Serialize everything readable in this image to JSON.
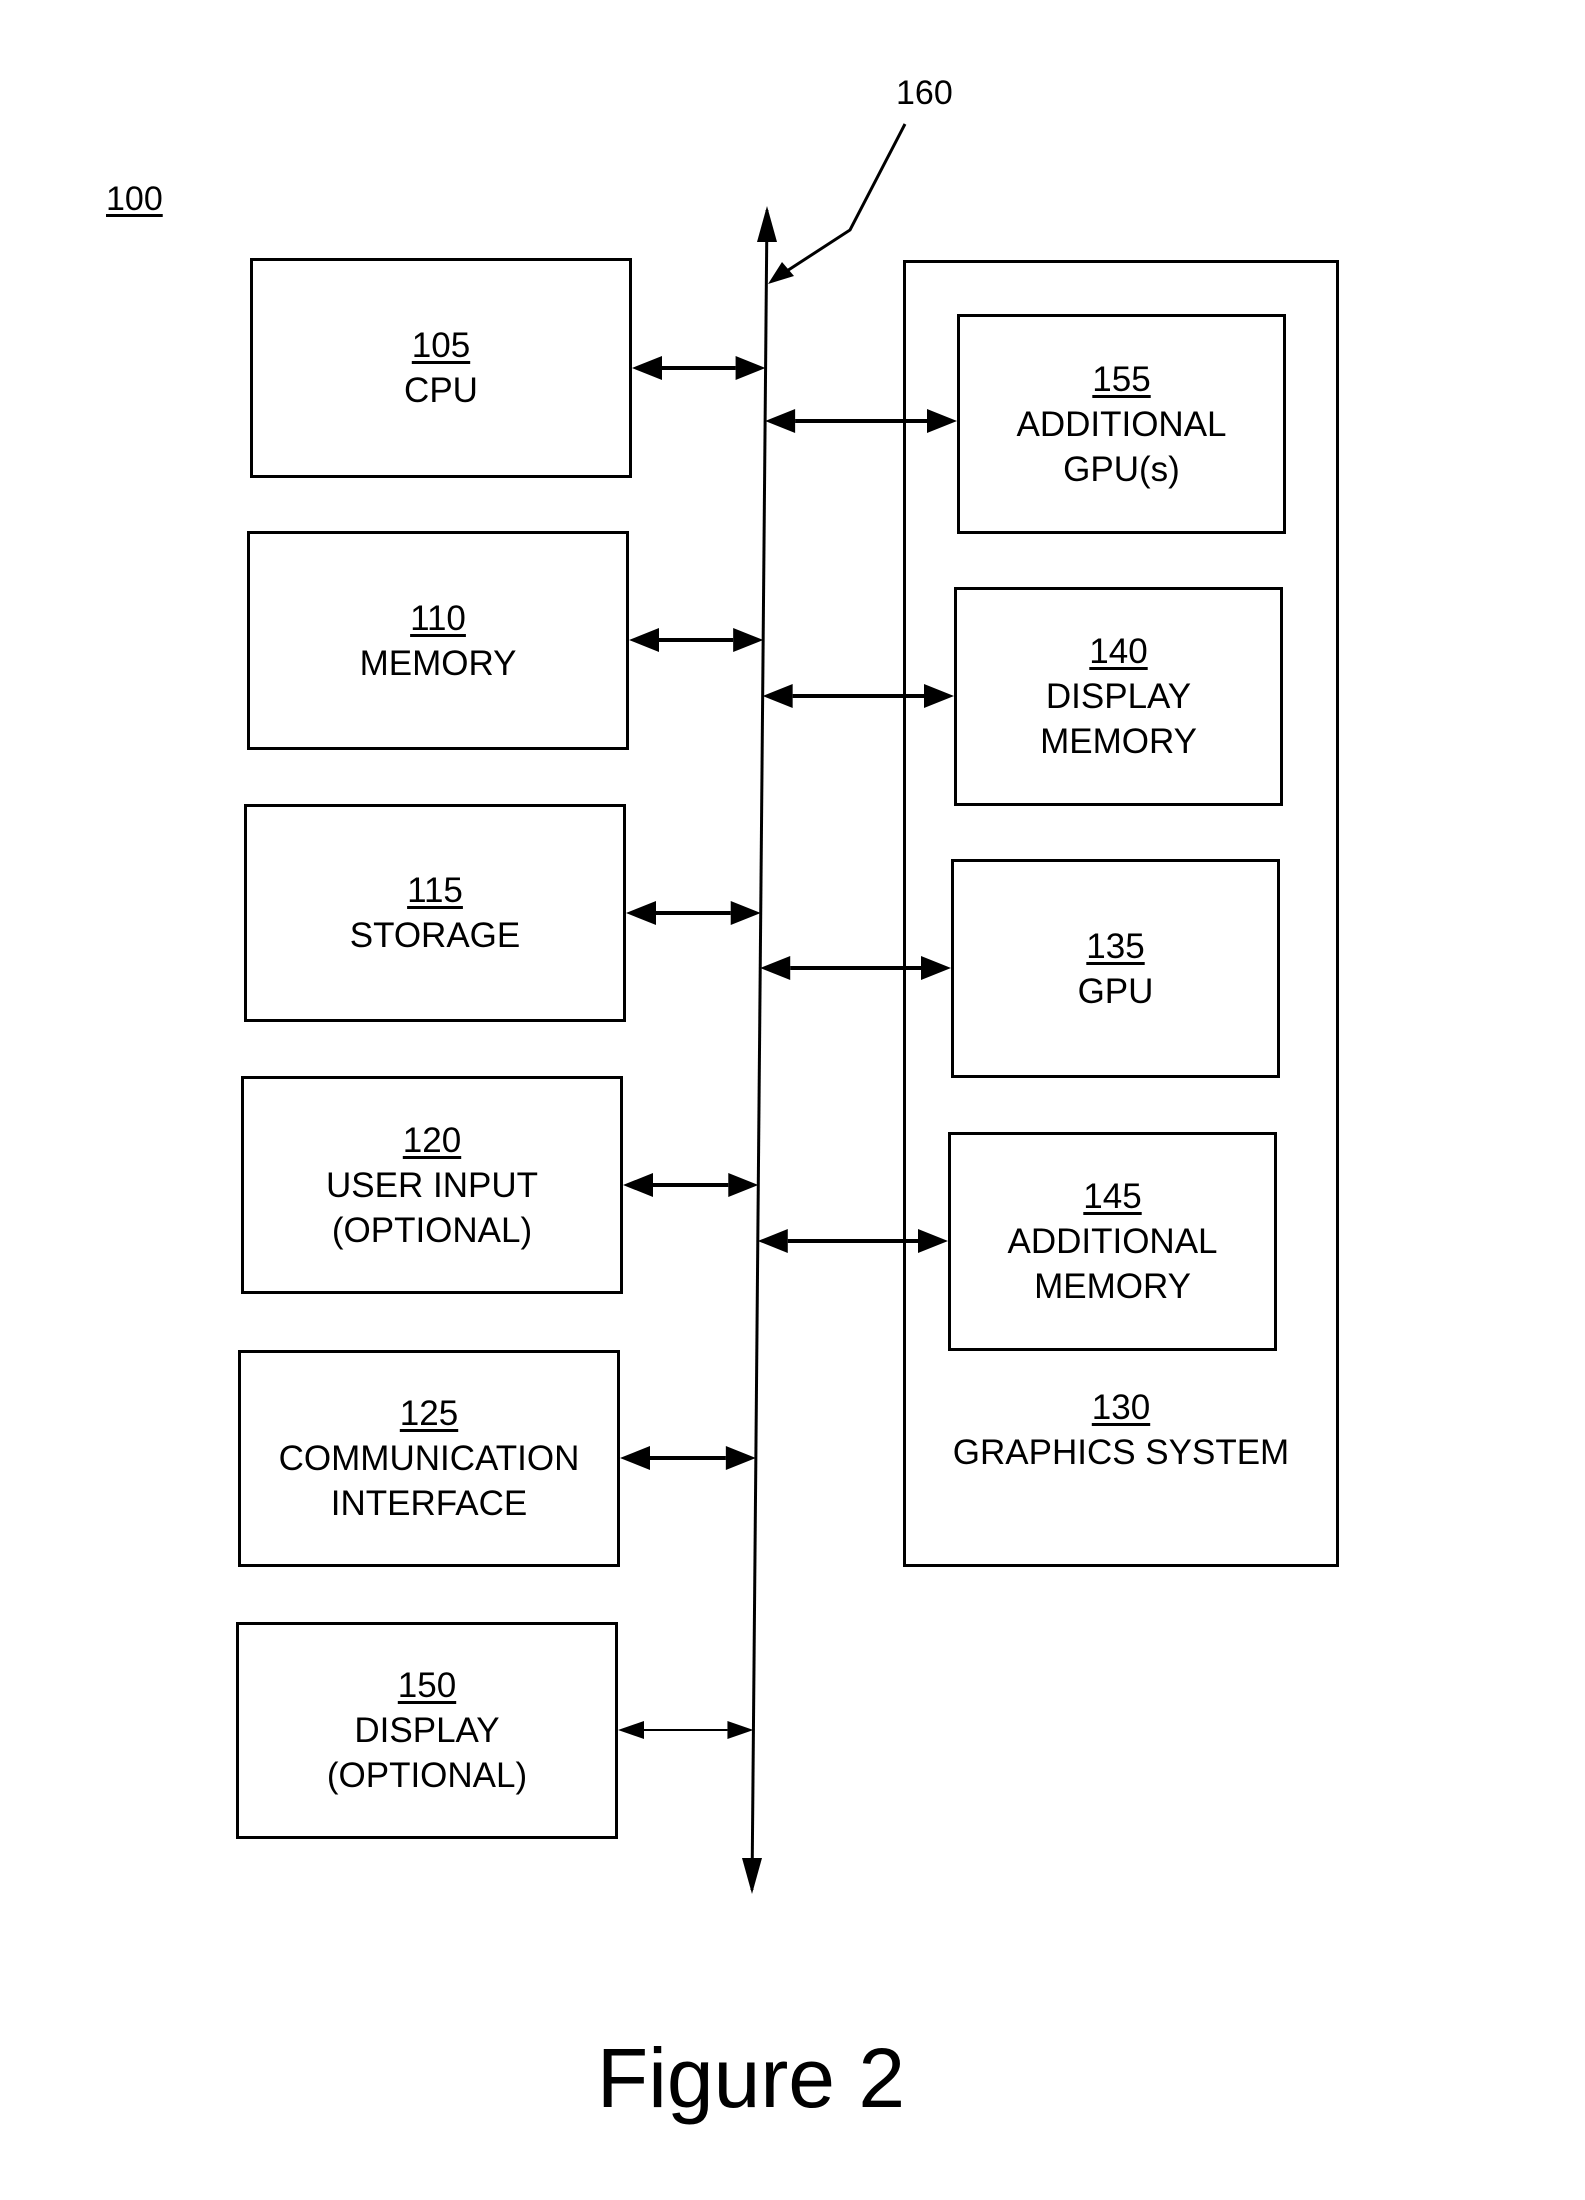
{
  "figure": {
    "system_ref": "100",
    "bus_ref": "160",
    "caption": "Figure 2"
  },
  "left_blocks": [
    {
      "ref": "105",
      "line1": "CPU",
      "line2": ""
    },
    {
      "ref": "110",
      "line1": "MEMORY",
      "line2": ""
    },
    {
      "ref": "115",
      "line1": "STORAGE",
      "line2": ""
    },
    {
      "ref": "120",
      "line1": "USER INPUT",
      "line2": "(OPTIONAL)"
    },
    {
      "ref": "125",
      "line1": "COMMUNICATION",
      "line2": "INTERFACE"
    },
    {
      "ref": "150",
      "line1": "DISPLAY",
      "line2": "(OPTIONAL)"
    }
  ],
  "graphics_system": {
    "ref": "130",
    "label": "GRAPHICS SYSTEM",
    "blocks": [
      {
        "ref": "155",
        "line1": "ADDITIONAL",
        "line2": "GPU(s)"
      },
      {
        "ref": "140",
        "line1": "DISPLAY",
        "line2": "MEMORY"
      },
      {
        "ref": "135",
        "line1": "GPU",
        "line2": ""
      },
      {
        "ref": "145",
        "line1": "ADDITIONAL",
        "line2": "MEMORY"
      }
    ]
  }
}
